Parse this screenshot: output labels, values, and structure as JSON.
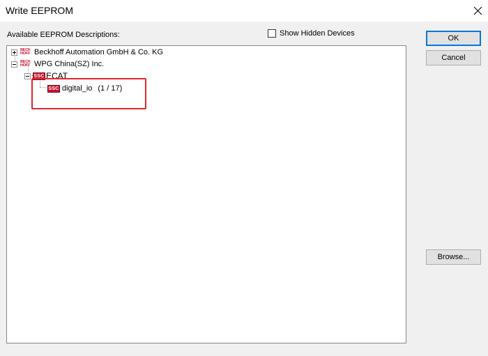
{
  "window": {
    "title": "Write EEPROM"
  },
  "header": {
    "list_label": "Available EEPROM Descriptions:",
    "show_hidden_label": "Show Hidden Devices",
    "show_hidden_checked": false
  },
  "tree": {
    "vendor1": {
      "label": "Beckhoff Automation GmbH & Co. KG",
      "logo_top": "BECK",
      "logo_bottom": "HOFF",
      "expanded": false
    },
    "vendor2": {
      "label": "WPG China(SZ) Inc.",
      "logo_top": "BECK",
      "logo_bottom": "HOFF",
      "expanded": true
    },
    "group": {
      "label": "ECAT",
      "logo": "SSC",
      "expanded": true
    },
    "device": {
      "label": "digital_io",
      "revision": "(1 / 17)",
      "logo": "SSC"
    }
  },
  "buttons": {
    "ok": "OK",
    "cancel": "Cancel",
    "browse": "Browse..."
  },
  "colors": {
    "highlight": "#e0262c",
    "brand_red": "#c8102e",
    "default_button_border": "#0078d7"
  }
}
